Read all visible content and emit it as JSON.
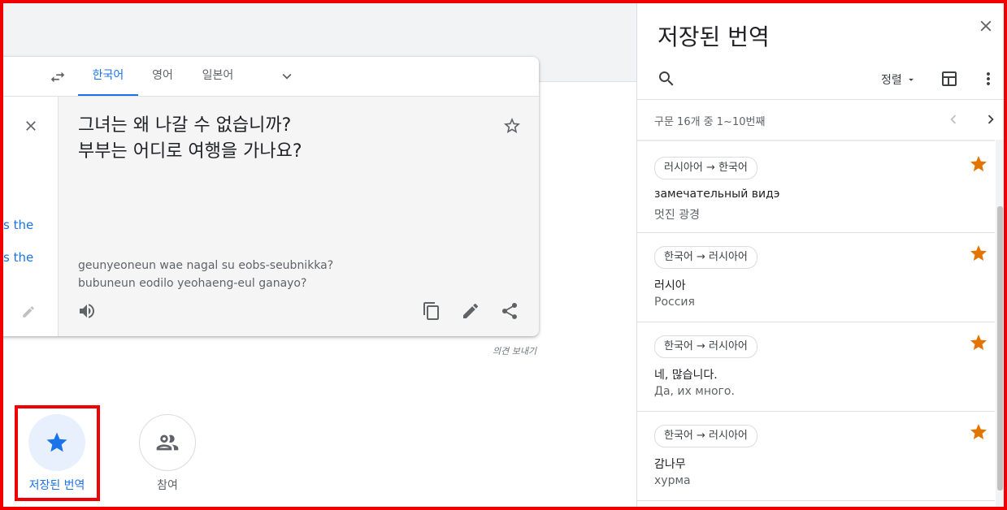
{
  "translator": {
    "tabs": [
      "한국어",
      "영어",
      "일본어"
    ],
    "source_partial_lines": [
      "s the",
      "s the"
    ],
    "output_lines": [
      "그녀는 왜 나갈 수 없습니까?",
      "부부는 어디로 여행을 가나요?"
    ],
    "romanization_lines": [
      "geunyeoneun wae nagal su eobs-seubnikka?",
      "bubuneun eodilo yeohaeng-eul ganayo?"
    ],
    "feedback": "의견 보내기"
  },
  "bottom_buttons": {
    "saved_label": "저장된 번역",
    "community_label": "참여"
  },
  "saved_panel": {
    "title": "저장된 번역",
    "sort_label": "정렬",
    "count_text": "구문 16개 중 1~10번째",
    "items": [
      {
        "pair": "러시아어 → 한국어",
        "source": "замечательный видэ",
        "translation": "멋진 광경"
      },
      {
        "pair": "한국어 → 러시아어",
        "source": "러시아",
        "translation": "Россия"
      },
      {
        "pair": "한국어 → 러시아어",
        "source": "네, 많습니다.",
        "translation": "Да, их много."
      },
      {
        "pair": "한국어 → 러시아어",
        "source": "감나무",
        "translation": "хурма"
      }
    ]
  },
  "colors": {
    "accent": "#1a73e8",
    "star_saved": "#e37400",
    "highlight": "#f00000"
  }
}
